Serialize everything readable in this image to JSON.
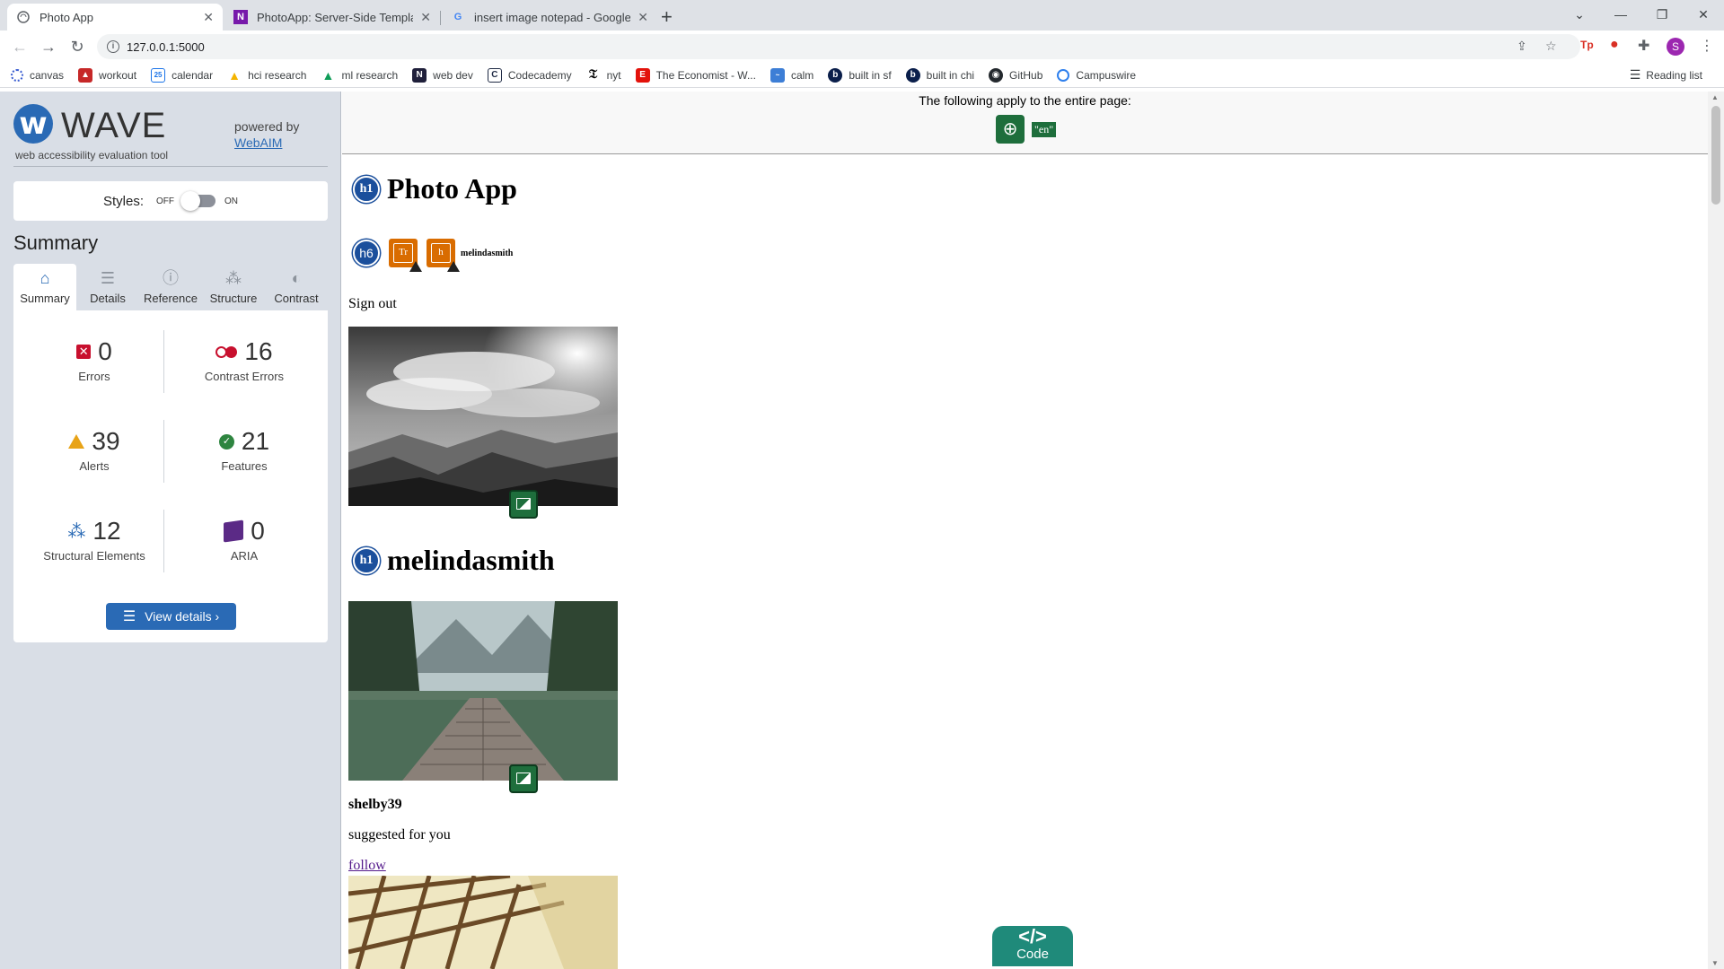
{
  "browser": {
    "tabs": [
      {
        "title": "Photo App",
        "active": true
      },
      {
        "title": "PhotoApp: Server-Side Template",
        "active": false
      },
      {
        "title": "insert image notepad - Google S",
        "active": false
      }
    ],
    "url": "127.0.0.1:5000",
    "profile_initial": "S",
    "bookmarks": [
      {
        "label": "canvas",
        "icon": "canvas-icon",
        "color": "#3b5ed1"
      },
      {
        "label": "workout",
        "icon": "workout-icon",
        "color": "#c62828"
      },
      {
        "label": "calendar",
        "icon": "calendar-icon",
        "color": "#1a73e8"
      },
      {
        "label": "hci research",
        "icon": "drive-icon",
        "color": "#f4b400"
      },
      {
        "label": "ml research",
        "icon": "drive-icon",
        "color": "#0f9d58"
      },
      {
        "label": "web dev",
        "icon": "onenote-icon",
        "color": "#7719aa"
      },
      {
        "label": "Codecademy",
        "icon": "codecademy-icon",
        "color": "#1f2a44"
      },
      {
        "label": "nyt",
        "icon": "nyt-icon",
        "color": "#000000"
      },
      {
        "label": "The Economist - W...",
        "icon": "economist-icon",
        "color": "#e3120b"
      },
      {
        "label": "calm",
        "icon": "calm-icon",
        "color": "#3d7ed6"
      },
      {
        "label": "built in sf",
        "icon": "builtin-icon",
        "color": "#0b1f4b"
      },
      {
        "label": "built in chi",
        "icon": "builtin-icon",
        "color": "#0b1f4b"
      },
      {
        "label": "GitHub",
        "icon": "github-icon",
        "color": "#24292e"
      },
      {
        "label": "Campuswire",
        "icon": "campuswire-icon",
        "color": "#2f80ed"
      }
    ],
    "reading_list": "Reading list"
  },
  "wave": {
    "logo_text": "WAVE",
    "tagline": "web accessibility evaluation tool",
    "powered_by": "powered by",
    "webaim": "WebAIM",
    "styles_label": "Styles:",
    "styles_off": "OFF",
    "styles_on": "ON",
    "summary_heading": "Summary",
    "tabs": [
      {
        "label": "Summary",
        "icon": "home-icon",
        "active": true
      },
      {
        "label": "Details",
        "icon": "list-icon",
        "active": false
      },
      {
        "label": "Reference",
        "icon": "info-icon",
        "active": false
      },
      {
        "label": "Structure",
        "icon": "structure-icon",
        "active": false
      },
      {
        "label": "Contrast",
        "icon": "contrast-icon",
        "active": false
      }
    ],
    "stats": {
      "errors": {
        "value": "0",
        "label": "Errors",
        "color": "#c8102e"
      },
      "contrast_errors": {
        "value": "16",
        "label": "Contrast Errors",
        "color": "#c8102e"
      },
      "alerts": {
        "value": "39",
        "label": "Alerts",
        "color": "#e8a317"
      },
      "features": {
        "value": "21",
        "label": "Features",
        "color": "#2e8540"
      },
      "structural": {
        "value": "12",
        "label": "Structural Elements",
        "color": "#2a6ab5"
      },
      "aria": {
        "value": "0",
        "label": "ARIA",
        "color": "#5b2a86"
      }
    },
    "view_details": "View details ›"
  },
  "page": {
    "notice": "The following apply to the entire page:",
    "lang_tag": "\"en\"",
    "h1_badge": "h1",
    "h6_badge": "h6",
    "title": "Photo App",
    "header_username": "melindasmith",
    "sign_out": "Sign out",
    "profile_heading": "melindasmith",
    "suggestion_user": "shelby39",
    "suggested_text": "suggested for you",
    "follow": "follow",
    "code_label": "Code",
    "code_symbol": "</>"
  }
}
